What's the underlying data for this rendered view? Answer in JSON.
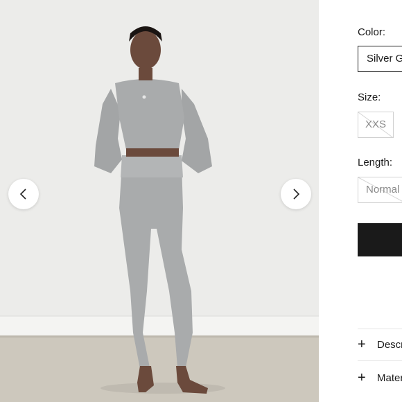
{
  "gallery": {
    "prev_icon": "chevron-left-icon",
    "next_icon": "chevron-right-icon"
  },
  "options": {
    "color_label": "Color:",
    "color_value": "Silver G",
    "size_label": "Size:",
    "size_value": "XXS",
    "length_label": "Length:",
    "length_value": "Normal"
  },
  "accordion": {
    "description_label": "Descr",
    "materials_label": "Mater",
    "expand_icon": "plus-icon"
  },
  "colors": {
    "add_button": "#1a1a1a",
    "product": "#a9abac"
  }
}
